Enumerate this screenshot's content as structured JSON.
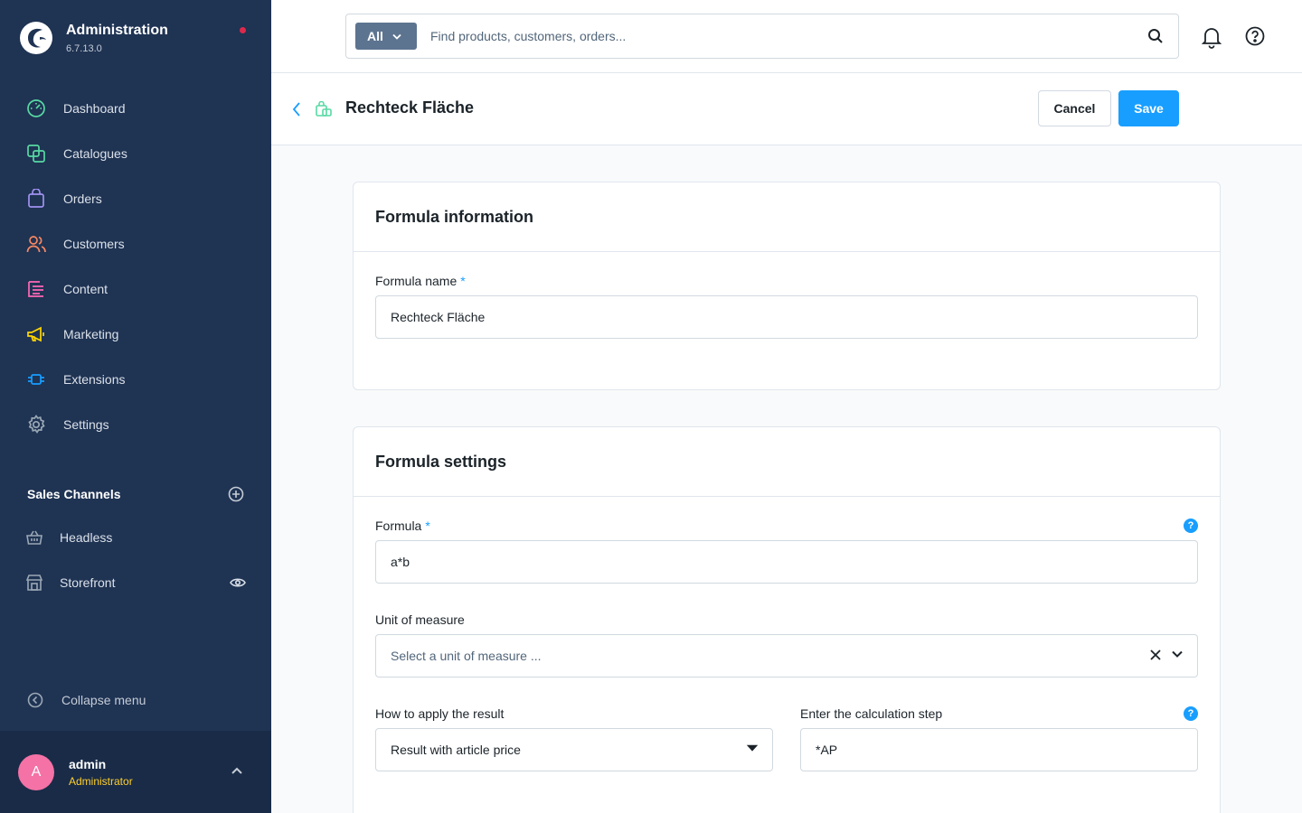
{
  "app": {
    "title": "Administration",
    "version": "6.7.13.0"
  },
  "nav": [
    {
      "label": "Dashboard",
      "icon": "dashboard-icon",
      "color": "#57d9a3"
    },
    {
      "label": "Catalogues",
      "icon": "catalogue-icon",
      "color": "#57d9a3"
    },
    {
      "label": "Orders",
      "icon": "orders-icon",
      "color": "#a092f0"
    },
    {
      "label": "Customers",
      "icon": "customers-icon",
      "color": "#f88962"
    },
    {
      "label": "Content",
      "icon": "content-icon",
      "color": "#ff68b4"
    },
    {
      "label": "Marketing",
      "icon": "marketing-icon",
      "color": "#ffd700"
    },
    {
      "label": "Extensions",
      "icon": "extensions-icon",
      "color": "#189eff"
    },
    {
      "label": "Settings",
      "icon": "settings-icon",
      "color": "#9aa8b5"
    }
  ],
  "sales_channels": {
    "title": "Sales Channels",
    "items": [
      {
        "label": "Headless"
      },
      {
        "label": "Storefront"
      }
    ]
  },
  "collapse_label": "Collapse menu",
  "user": {
    "initial": "A",
    "name": "admin",
    "role": "Administrator"
  },
  "search": {
    "type": "All",
    "placeholder": "Find products, customers, orders..."
  },
  "smartbar": {
    "title": "Rechteck Fläche",
    "cancel": "Cancel",
    "save": "Save"
  },
  "formula_info": {
    "title": "Formula information",
    "name_label": "Formula name",
    "name_value": "Rechteck Fläche"
  },
  "formula_settings": {
    "title": "Formula settings",
    "formula_label": "Formula",
    "formula_value": "a*b",
    "unit_label": "Unit of measure",
    "unit_placeholder": "Select a unit of measure ...",
    "apply_label": "How to apply the result",
    "apply_value": "Result with article price",
    "step_label": "Enter the calculation step",
    "step_value": "*AP"
  },
  "required_mark": "*",
  "help_mark": "?"
}
